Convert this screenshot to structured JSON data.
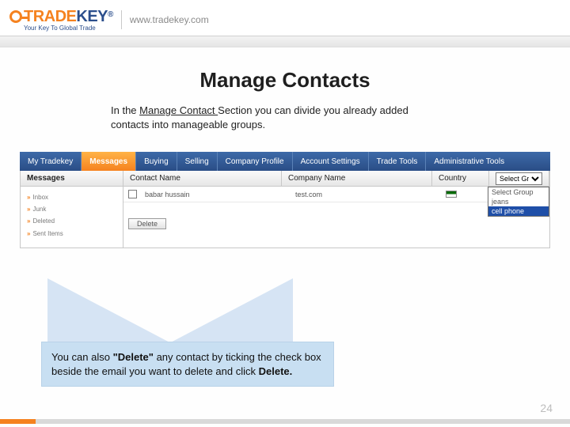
{
  "header": {
    "logo_trade": "TRADE",
    "logo_key": "KEY",
    "logo_r": "®",
    "tagline": "Your Key To Global Trade",
    "url": "www.tradekey.com"
  },
  "title": "Manage Contacts",
  "intro": {
    "pre": "In the ",
    "underlined": "Manage Contact ",
    "post": "Section you can divide you already added contacts into manageable groups."
  },
  "topnav": [
    "My Tradekey",
    "Messages",
    "Buying",
    "Selling",
    "Company Profile",
    "Account Settings",
    "Trade Tools",
    "Administrative Tools"
  ],
  "topnav_active_index": 1,
  "columns": {
    "messages": "Messages",
    "contact": "Contact Name",
    "company": "Company Name",
    "country": "Country",
    "group_selected": "Select Group"
  },
  "sidebar_items": [
    "Inbox",
    "Junk",
    "Deleted",
    "Sent Items"
  ],
  "row": {
    "contact": "babar hussain",
    "company": "test.com"
  },
  "dropdown_options": [
    "Select Group",
    "jeans",
    "cell phone"
  ],
  "dropdown_highlight_index": 2,
  "delete_label": "Delete",
  "callout": {
    "a": "You can also ",
    "b": "\"Delete\"",
    "c": " any contact by ticking the check box beside the email you want to delete and click ",
    "d": "Delete."
  },
  "page_number": "24"
}
